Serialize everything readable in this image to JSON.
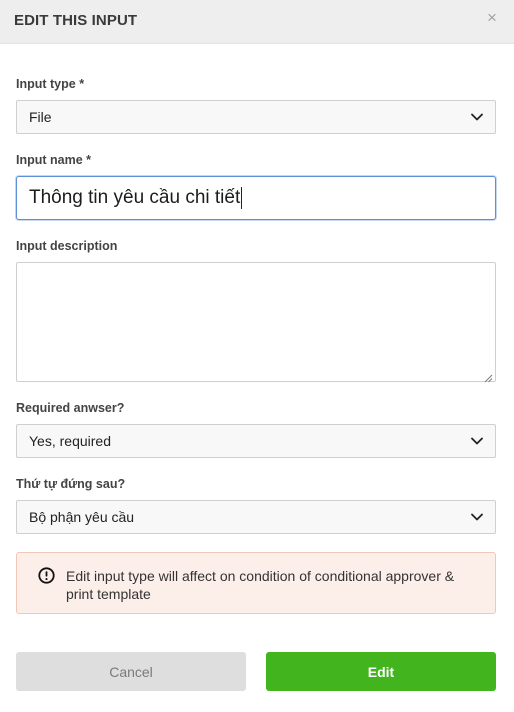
{
  "modal": {
    "title": "EDIT THIS INPUT",
    "close_glyph": "×"
  },
  "form": {
    "input_type": {
      "label": "Input type *",
      "value": "File"
    },
    "input_name": {
      "label": "Input name *",
      "value": "Thông tin yêu cầu chi tiết"
    },
    "input_description": {
      "label": "Input description",
      "value": ""
    },
    "required_answer": {
      "label": "Required anwser?",
      "value": "Yes, required"
    },
    "order_after": {
      "label": "Thứ tự đứng sau?",
      "value": "Bộ phận yêu cầu"
    }
  },
  "alert": {
    "icon": "exclamation-circle-icon",
    "message": "Edit input type will affect on condition of conditional approver & print template"
  },
  "buttons": {
    "cancel": "Cancel",
    "edit": "Edit"
  },
  "colors": {
    "header_bg": "#eeeeee",
    "edit_button": "#42b51e",
    "cancel_button": "#dedede",
    "alert_bg": "#fcefea",
    "alert_border": "#f1c7b7",
    "focus_border": "#5b8fd6"
  }
}
